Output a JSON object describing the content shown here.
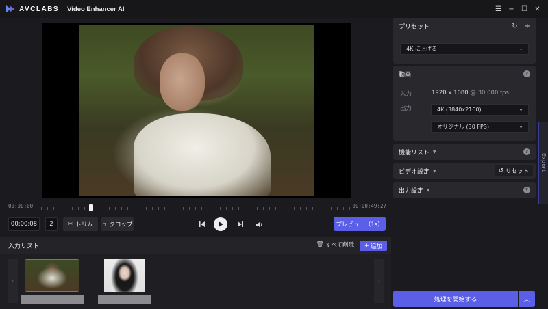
{
  "app": {
    "brand": "AVCLABS",
    "title": "Video Enhancer AI",
    "controls": {
      "menu": "☰",
      "minimize": "−",
      "maximize": "☐",
      "close": "✕"
    }
  },
  "player": {
    "time_start": "00:00:00",
    "time_end": "00:00:49:27",
    "playhead_fraction": 0.16,
    "current_time": "00:00:08",
    "frame": "2",
    "trim_label": "トリム",
    "crop_label": "クロップ",
    "preview_label": "プレビュー（1s）"
  },
  "input_list": {
    "title": "入力リスト",
    "clear_label": "すべて削除",
    "add_label": "追加"
  },
  "preset": {
    "title": "プリセット",
    "selected": "4K に上げる"
  },
  "video": {
    "title": "動画",
    "input_label": "入力",
    "input_resolution": "1920 x 1080",
    "input_fps": "@ 30.000 fps",
    "output_label": "出力",
    "output_resolution": "4K (3840x2160)",
    "output_fps": "オリジナル (30 FPS)"
  },
  "features": {
    "title": "機能リスト"
  },
  "video_settings": {
    "title": "ビデオ設定",
    "reset_label": "リセット"
  },
  "output_settings": {
    "title": "出力設定"
  },
  "export_tab": "Export",
  "start_label": "処理を開始する",
  "colors": {
    "accent": "#5b5fe8",
    "panel": "#28282d",
    "background": "#1b1b1f"
  }
}
